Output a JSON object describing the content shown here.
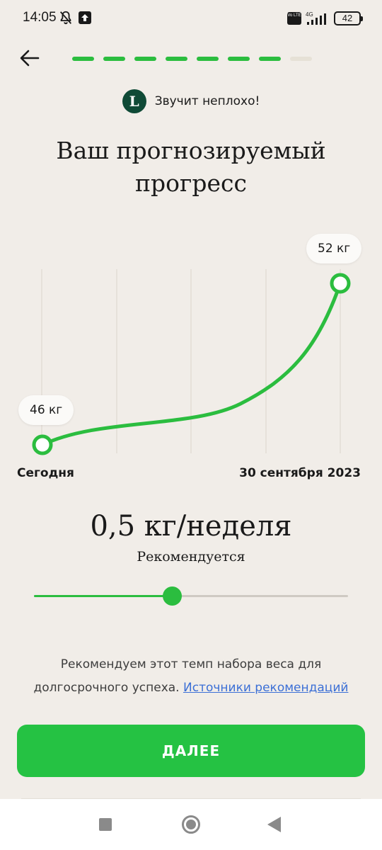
{
  "status": {
    "time": "14:05",
    "volte": "Vo LTE",
    "network": "4G",
    "battery": "42"
  },
  "header": {
    "progress": {
      "total_steps": 8,
      "completed_steps": 7
    },
    "logo_letter": "L",
    "badge_text": "Звучит неплохо!",
    "title": "Ваш прогнозируемый прогресс"
  },
  "chart": {
    "start_label": "46 кг",
    "end_label": "52 кг",
    "x_start": "Сегодня",
    "x_end": "30 сентября 2023"
  },
  "rate": {
    "value": "0,5 кг/неделя",
    "subtitle": "Рекомендуется",
    "slider_level": 0.44
  },
  "advice": {
    "text": "Рекомендуем этот темп набора веса для долгосрочного успеха.",
    "link": "Источники рекомендаций"
  },
  "cta": {
    "label": "ДАЛЕЕ"
  },
  "colors": {
    "accent": "#2bbd3f",
    "background": "#f1ede8",
    "logo": "#0f4a36",
    "link": "#3b6fd6"
  },
  "icons": {
    "back": "arrow-left-icon",
    "bell": "bell-off-icon",
    "upload": "upload-icon",
    "signal": "signal-icon",
    "battery": "battery-icon"
  }
}
